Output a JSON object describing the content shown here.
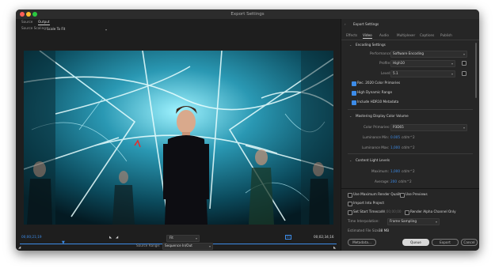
{
  "window": {
    "title": "Export Settings"
  },
  "left": {
    "tabs": [
      "Source",
      "Output"
    ],
    "scaling_label": "Source Scaling:",
    "scaling_value": "Scale To Fit",
    "timecode_in": "00;00;21;19",
    "timecode_out": "00;02;34;16",
    "fit_value": "Fit",
    "source_range_label": "Source Range:",
    "source_range_value": "Sequence In/Out"
  },
  "right": {
    "export_settings_label": "Export Settings",
    "tabs": [
      "Effects",
      "Video",
      "Audio",
      "Multiplexer",
      "Captions",
      "Publish"
    ],
    "encoding_settings": "Encoding Settings",
    "performance_label": "Performance:",
    "performance_value": "Software Encoding",
    "profile_label": "Profile:",
    "profile_value": "High10",
    "level_label": "Level:",
    "level_value": "5.1",
    "rec2020": "Rec. 2020 Color Primaries",
    "hdr": "High Dynamic Range",
    "hdr10": "Include HDR10 Metadata",
    "mastering": "Mastering Display Color Volume",
    "color_primaries_label": "Color Primaries:",
    "color_primaries_value": "P3D65",
    "lum_min_label": "Luminance Min:",
    "lum_min_value": "0.005",
    "lum_max_label": "Luminance Max:",
    "lum_max_value": "1,000",
    "unit": "cd/m^2",
    "content_light": "Content Light Levels",
    "maximum_label": "Maximum:",
    "maximum_value": "1,000",
    "average_label": "Average:",
    "average_value": "200",
    "use_max_quality": "Use Maximum Render Quality",
    "use_previews": "Use Previews",
    "import_project": "Import Into Project",
    "set_start_tc": "Set Start Timecode",
    "start_tc_value": "00;00;00;00",
    "render_alpha": "Render Alpha Channel Only",
    "time_interp_label": "Time Interpolation:",
    "time_interp_value": "Frame Sampling",
    "est_size_label": "Estimated File Size:",
    "est_size_value": "38 MB",
    "buttons": {
      "metadata": "Metadata...",
      "queue": "Queue",
      "export": "Export",
      "cancel": "Cancel"
    }
  },
  "colors": {
    "accent": "#3d8ce8",
    "close": "#fc5f57",
    "minimize": "#fdbc2e",
    "zoom": "#2ac840"
  }
}
